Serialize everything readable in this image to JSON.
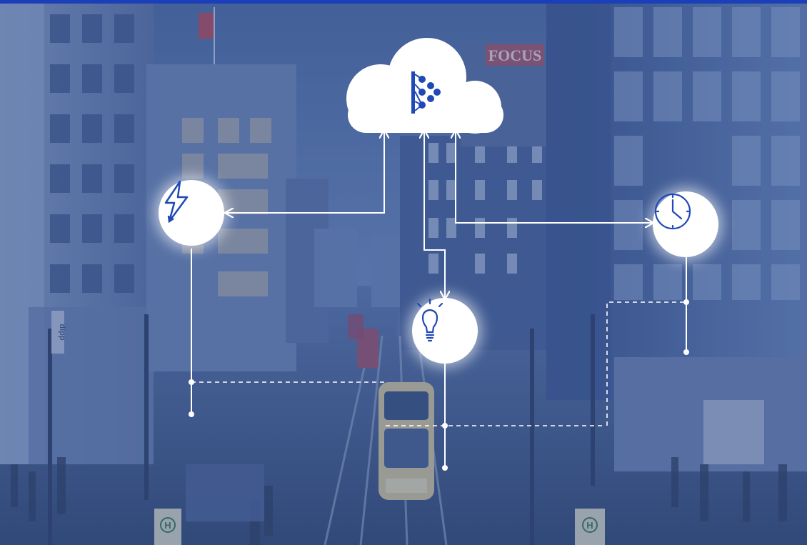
{
  "colors": {
    "top_bar": "#1b3fb8",
    "overlay": "#2f4f8a",
    "sky": "#7f9bd0",
    "icon_blue": "#1f49b6",
    "line": "#ffffff"
  },
  "diagram": {
    "hub": {
      "icon": "neural-network-icon"
    },
    "nodes": [
      {
        "id": "power",
        "icon": "lightning-bolt-icon"
      },
      {
        "id": "lighting",
        "icon": "light-bulb-icon"
      },
      {
        "id": "time",
        "icon": "clock-icon"
      }
    ]
  },
  "signage": {
    "store_sign": "FOCUS",
    "tram_stop_left": "H",
    "tram_stop_right": "H",
    "vertical_sign": "dipp"
  }
}
